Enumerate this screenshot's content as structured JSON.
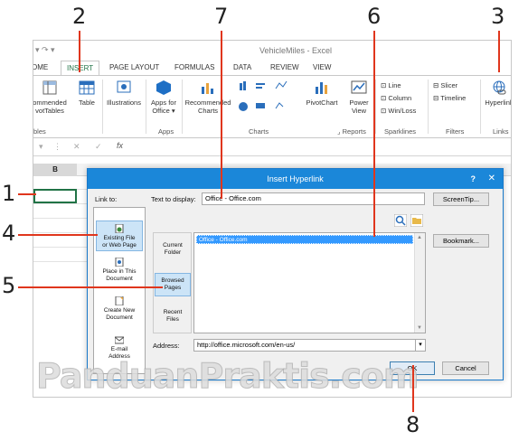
{
  "window": {
    "title": "VehicleMiles - Excel"
  },
  "ribbon_tabs": [
    "OME",
    "INSERT",
    "PAGE LAYOUT",
    "FORMULAS",
    "DATA",
    "REVIEW",
    "VIEW"
  ],
  "ribbon": {
    "recommended_pivot": "ommended\nvotTables",
    "table": "Table",
    "illustrations": "Illustrations",
    "apps_for_office": "Apps for\nOffice ▾",
    "recommended_charts": "Recommended\nCharts",
    "pivotchart": "PivotChart",
    "power_view": "Power\nView",
    "line": "Line",
    "column": "Column",
    "win_loss": "Win/Loss",
    "slicer": "Slicer",
    "timeline": "Timeline",
    "hyperlink": "Hyperlink",
    "groups": {
      "tables": "bles",
      "apps": "Apps",
      "charts": "Charts",
      "reports": "Reports",
      "sparklines": "Sparklines",
      "filters": "Filters",
      "links": "Links"
    }
  },
  "formula_bar": {
    "fx": "fx"
  },
  "sheet": {
    "column_b": "B"
  },
  "dialog": {
    "title": "Insert Hyperlink",
    "help": "?",
    "close": "✕",
    "link_to_label": "Link to:",
    "text_to_display_label": "Text to display:",
    "text_to_display_value": "Office - Office.com",
    "screentip_button": "ScreenTip...",
    "link_items": [
      {
        "label": "Existing File\nor Web Page",
        "selected": true
      },
      {
        "label": "Place in This\nDocument",
        "selected": false
      },
      {
        "label": "Create New\nDocument",
        "selected": false
      },
      {
        "label": "E-mail\nAddress",
        "selected": false
      }
    ],
    "side_items": [
      {
        "label": "Current\nFolder",
        "selected": false
      },
      {
        "label": "Browsed\nPages",
        "selected": true
      },
      {
        "label": "Recent\nFiles",
        "selected": false
      }
    ],
    "list_selected": "Office - Office.com",
    "bookmark_button": "Bookmark...",
    "address_label": "Address:",
    "address_value": "http://office.microsoft.com/en-us/",
    "ok_button": "OK",
    "cancel_button": "Cancel"
  },
  "callouts": [
    "1",
    "2",
    "3",
    "4",
    "5",
    "6",
    "7",
    "8"
  ],
  "watermark": "PanduanPraktis.com",
  "colors": {
    "accent": "#1b87d9",
    "excel_green": "#217346",
    "callout_line": "#e0361d"
  }
}
